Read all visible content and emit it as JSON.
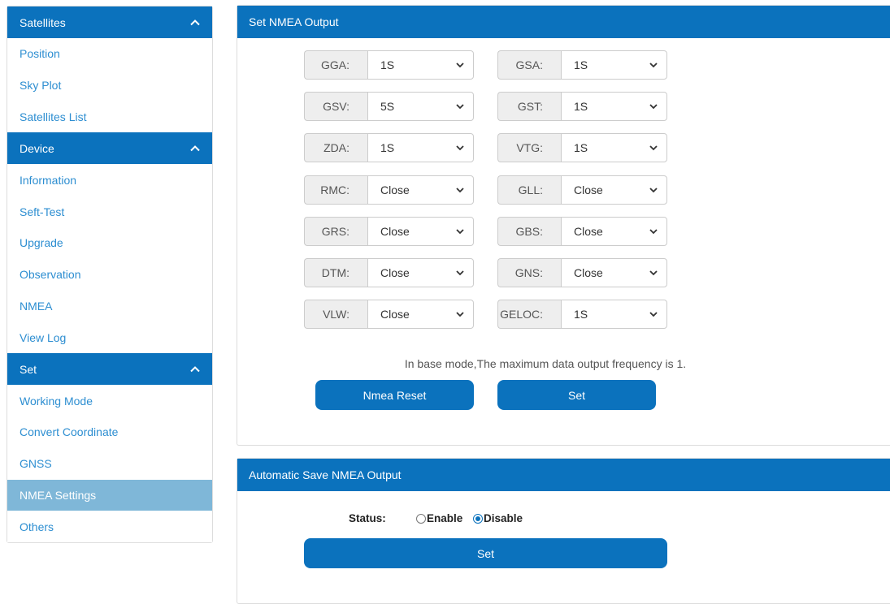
{
  "sidebar": {
    "groups": [
      {
        "title": "Satellites",
        "items": [
          "Position",
          "Sky Plot",
          "Satellites List"
        ]
      },
      {
        "title": "Device",
        "items": [
          "Information",
          "Seft-Test",
          "Upgrade",
          "Observation",
          "NMEA",
          "View Log"
        ]
      },
      {
        "title": "Set",
        "items": [
          "Working Mode",
          "Convert Coordinate",
          "GNSS",
          "NMEA Settings",
          "Others"
        ]
      }
    ],
    "active_item": "NMEA Settings"
  },
  "nmea_output": {
    "title": "Set NMEA Output",
    "fields": [
      {
        "label": "GGA:",
        "value": "1S"
      },
      {
        "label": "GSA:",
        "value": "1S"
      },
      {
        "label": "GSV:",
        "value": "5S"
      },
      {
        "label": "GST:",
        "value": "1S"
      },
      {
        "label": "ZDA:",
        "value": "1S"
      },
      {
        "label": "VTG:",
        "value": "1S"
      },
      {
        "label": "RMC:",
        "value": "Close"
      },
      {
        "label": "GLL:",
        "value": "Close"
      },
      {
        "label": "GRS:",
        "value": "Close"
      },
      {
        "label": "GBS:",
        "value": "Close"
      },
      {
        "label": "DTM:",
        "value": "Close"
      },
      {
        "label": "GNS:",
        "value": "Close"
      },
      {
        "label": "VLW:",
        "value": "Close"
      },
      {
        "label": "GELOC:",
        "value": "1S"
      }
    ],
    "note": "In base mode,The maximum data output frequency is 1.",
    "reset_label": "Nmea Reset",
    "set_label": "Set"
  },
  "auto_save": {
    "title": "Automatic Save NMEA Output",
    "status_label": "Status:",
    "enable_label": "Enable",
    "disable_label": "Disable",
    "selected": "Disable",
    "set_label": "Set"
  },
  "colors": {
    "primary": "#0b72bd",
    "link": "#2d8ed1",
    "active_bg": "#7fb7d8"
  }
}
